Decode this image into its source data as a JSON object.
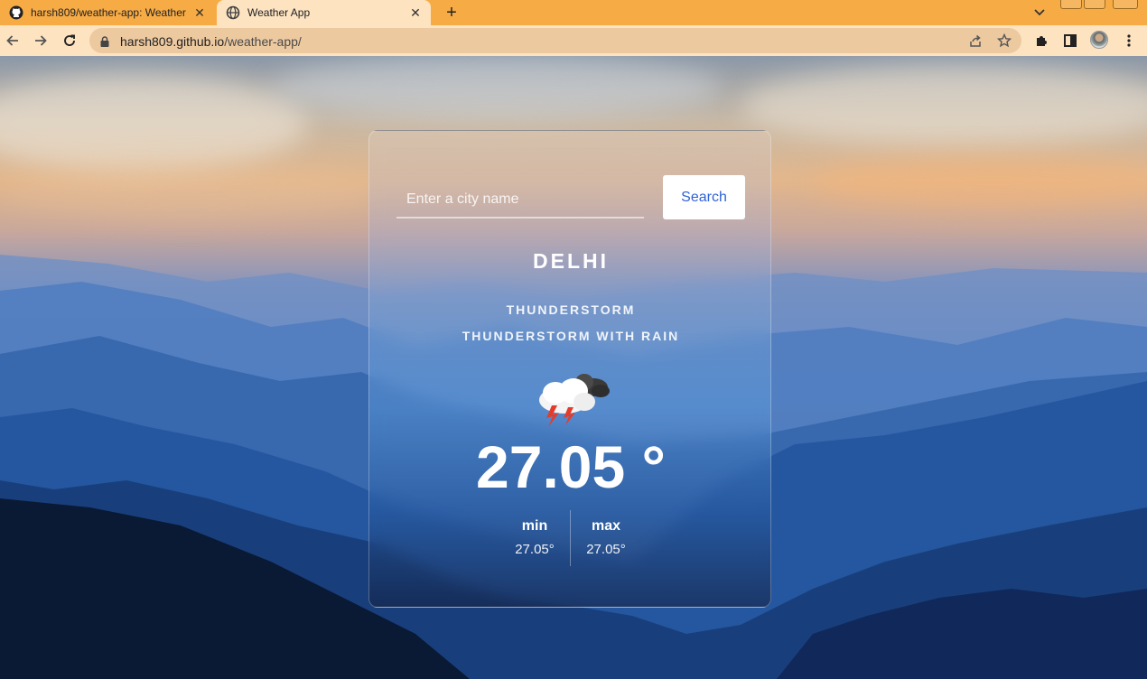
{
  "browser": {
    "tabs": [
      {
        "title": "harsh809/weather-app: Weather",
        "icon": "github-icon"
      },
      {
        "title": "Weather App",
        "icon": "globe-icon"
      }
    ],
    "url_domain": "harsh809.github.io",
    "url_path": "/weather-app/"
  },
  "weather": {
    "search_placeholder": "Enter a city name",
    "search_button": "Search",
    "city": "DELHI",
    "condition_main": "THUNDERSTORM",
    "condition_description": "THUNDERSTORM WITH RAIN",
    "icon": "thunderstorm-icon",
    "temperature": "27.05 °",
    "min_label": "min",
    "min_value": "27.05°",
    "max_label": "max",
    "max_value": "27.05°"
  },
  "colors": {
    "tabbar": "#f7ab45",
    "toolbar": "#fde3c0",
    "search_button_text": "#2f62d8"
  }
}
